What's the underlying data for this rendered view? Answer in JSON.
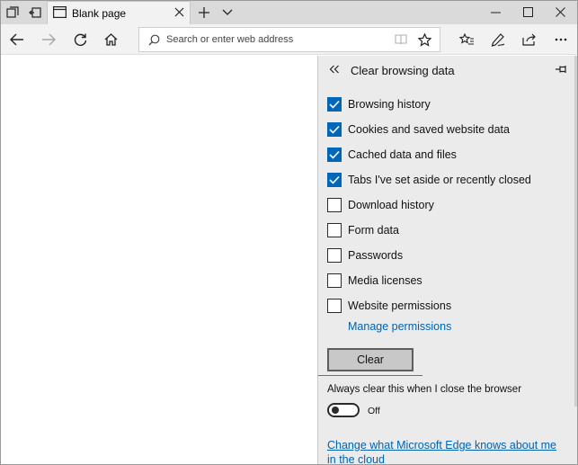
{
  "tab": {
    "title": "Blank page"
  },
  "address": {
    "placeholder": "Search or enter web address"
  },
  "panel": {
    "title": "Clear browsing data",
    "options": [
      {
        "label": "Browsing history",
        "checked": true
      },
      {
        "label": "Cookies and saved website data",
        "checked": true
      },
      {
        "label": "Cached data and files",
        "checked": true
      },
      {
        "label": "Tabs I've set aside or recently closed",
        "checked": true
      },
      {
        "label": "Download history",
        "checked": false
      },
      {
        "label": "Form data",
        "checked": false
      },
      {
        "label": "Passwords",
        "checked": false
      },
      {
        "label": "Media licenses",
        "checked": false
      },
      {
        "label": "Website permissions",
        "checked": false
      }
    ],
    "manage_permissions": "Manage permissions",
    "clear_label": "Clear",
    "always_clear_label": "Always clear this when I close the browser",
    "toggle_state": "Off",
    "cloud_link": "Change what Microsoft Edge knows about me in the cloud"
  },
  "colors": {
    "accent": "#0067b8",
    "link": "#0063b1",
    "panel_bg": "#ebebeb",
    "tabbar_bg": "#dadada"
  },
  "icons": {
    "tab_actions": "tab-preview-icon",
    "tabs_aside": "tabs-aside-icon",
    "favicon": "blank-page-icon",
    "close": "close-icon",
    "new_tab": "plus-icon",
    "tab_menu": "chevron-down-icon",
    "back": "back-arrow-icon",
    "forward": "forward-arrow-icon",
    "refresh": "refresh-icon",
    "home": "home-icon",
    "search": "search-icon",
    "reading_view": "reading-view-icon",
    "favorite": "star-icon",
    "favorites_hub": "favorites-hub-icon",
    "notes": "pen-icon",
    "share": "share-icon",
    "more": "more-icon",
    "collapse": "double-chevron-left-icon",
    "pin": "pin-icon"
  }
}
